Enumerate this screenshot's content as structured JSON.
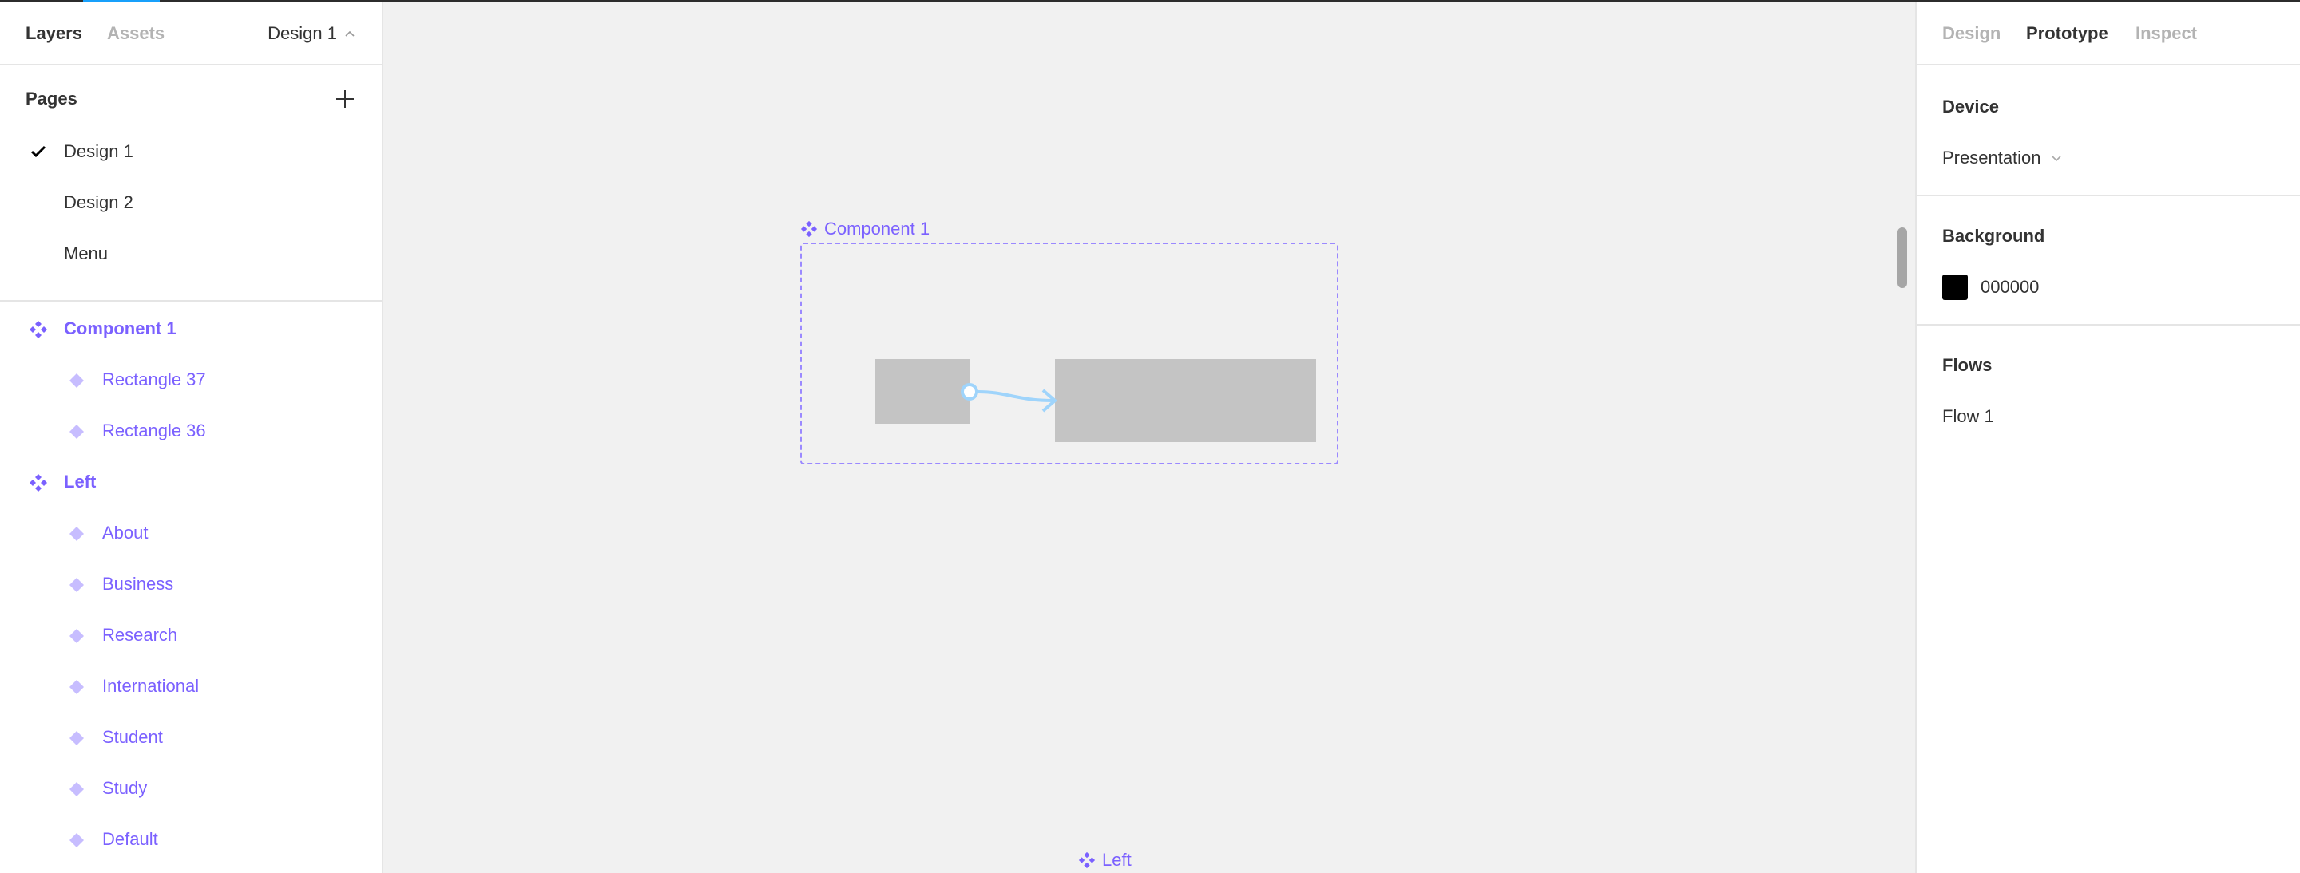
{
  "left_panel": {
    "tabs": [
      {
        "label": "Layers",
        "active": true
      },
      {
        "label": "Assets",
        "active": false
      }
    ],
    "current_page": "Design 1",
    "pages_title": "Pages",
    "pages": [
      {
        "label": "Design 1",
        "selected": true
      },
      {
        "label": "Design 2",
        "selected": false
      },
      {
        "label": "Menu",
        "selected": false
      }
    ],
    "layers": [
      {
        "label": "Component 1",
        "type": "component"
      },
      {
        "label": "Rectangle 37",
        "type": "instance"
      },
      {
        "label": "Rectangle 36",
        "type": "instance"
      },
      {
        "label": "Left",
        "type": "component"
      },
      {
        "label": "About",
        "type": "instance"
      },
      {
        "label": "Business",
        "type": "instance"
      },
      {
        "label": "Research",
        "type": "instance"
      },
      {
        "label": "International",
        "type": "instance"
      },
      {
        "label": "Student",
        "type": "instance"
      },
      {
        "label": "Study",
        "type": "instance"
      },
      {
        "label": "Default",
        "type": "instance"
      }
    ]
  },
  "canvas": {
    "frames": [
      {
        "label": "Component 1"
      },
      {
        "label": "Left"
      }
    ],
    "colors": {
      "component": "#7b61ff",
      "component_light": "#c7bdff",
      "rect_fill": "#c4c4c4",
      "flow_connector": "#9fd4fb"
    }
  },
  "right_panel": {
    "tabs": [
      {
        "label": "Design",
        "active": false
      },
      {
        "label": "Prototype",
        "active": true
      },
      {
        "label": "Inspect",
        "active": false
      }
    ],
    "device": {
      "title": "Device",
      "value": "Presentation"
    },
    "background": {
      "title": "Background",
      "color": "#000000",
      "hex": "000000"
    },
    "flows": {
      "title": "Flows",
      "items": [
        "Flow 1"
      ]
    }
  }
}
